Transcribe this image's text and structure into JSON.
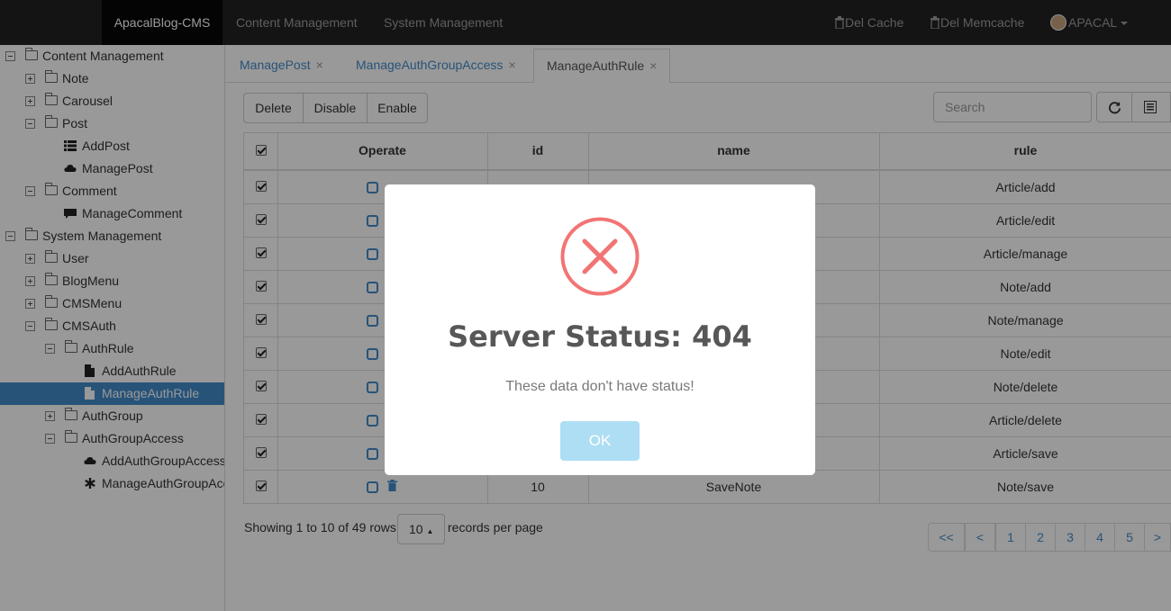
{
  "navbar": {
    "brand": "ApacalBlog-CMS",
    "menu": [
      "Content Management",
      "System Management"
    ],
    "del_cache": "Del Cache",
    "del_memcache": "Del Memcache",
    "user": "APACAL"
  },
  "sidebar": {
    "items": [
      {
        "label": "Content Management",
        "icon": "folder-icon"
      },
      {
        "label": "Note",
        "icon": "folder-icon"
      },
      {
        "label": "Carousel",
        "icon": "folder-icon"
      },
      {
        "label": "Post",
        "icon": "folder-icon"
      },
      {
        "label": "AddPost",
        "icon": "list-icon"
      },
      {
        "label": "ManagePost",
        "icon": "cloud-icon"
      },
      {
        "label": "Comment",
        "icon": "folder-icon"
      },
      {
        "label": "ManageComment",
        "icon": "comment-icon"
      },
      {
        "label": "System Management",
        "icon": "folder-icon"
      },
      {
        "label": "User",
        "icon": "folder-icon"
      },
      {
        "label": "BlogMenu",
        "icon": "folder-icon"
      },
      {
        "label": "CMSMenu",
        "icon": "folder-icon"
      },
      {
        "label": "CMSAuth",
        "icon": "folder-icon"
      },
      {
        "label": "AuthRule",
        "icon": "folder-icon"
      },
      {
        "label": "AddAuthRule",
        "icon": "file-icon"
      },
      {
        "label": "ManageAuthRule",
        "icon": "file-icon"
      },
      {
        "label": "AuthGroup",
        "icon": "folder-icon"
      },
      {
        "label": "AuthGroupAccess",
        "icon": "folder-icon"
      },
      {
        "label": "AddAuthGroupAccess",
        "icon": "cloud-icon"
      },
      {
        "label": "ManageAuthGroupAcce",
        "icon": "asterisk-icon"
      }
    ]
  },
  "tabs": [
    {
      "label": "ManagePost",
      "close": "×"
    },
    {
      "label": "ManageAuthGroupAccess",
      "close": "×"
    },
    {
      "label": "ManageAuthRule",
      "close": "×"
    }
  ],
  "toolbar": {
    "delete": "Delete",
    "disable": "Disable",
    "enable": "Enable",
    "search_placeholder": "Search"
  },
  "table": {
    "headers": [
      "Operate",
      "id",
      "name",
      "rule"
    ],
    "rows": [
      {
        "rule": "Article/add"
      },
      {
        "rule": "Article/edit"
      },
      {
        "rule": "Article/manage"
      },
      {
        "rule": "Note/add"
      },
      {
        "rule": "Note/manage"
      },
      {
        "rule": "Note/edit"
      },
      {
        "rule": "Note/delete"
      },
      {
        "rule": "Article/delete"
      },
      {
        "rule": "Article/save"
      },
      {
        "id": "10",
        "name": "SaveNote",
        "rule": "Note/save"
      }
    ]
  },
  "pagination": {
    "info": "Showing 1 to 10 of 49 rows",
    "page_size": "10",
    "suffix": "records per page",
    "buttons": [
      "<<",
      "<",
      "1",
      "2",
      "3",
      "4",
      "5",
      ">"
    ]
  },
  "modal": {
    "title": "Server Status: 404",
    "text": "These data don't have status!",
    "ok": "OK"
  },
  "colors": {
    "navbar": "#222222",
    "link": "#428bca",
    "error": "#f27474",
    "ok_button": "#aedef4"
  }
}
